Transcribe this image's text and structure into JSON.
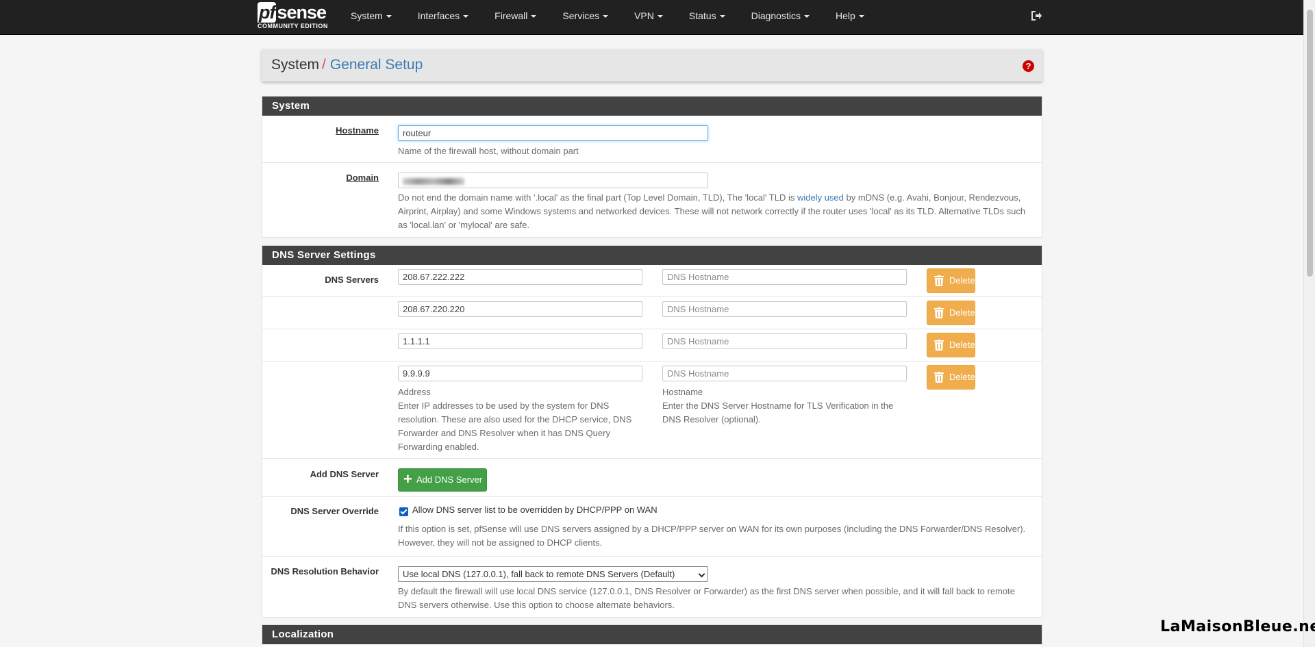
{
  "navbar": {
    "brand": "sense",
    "brand_pf": "pf",
    "edition": "COMMUNITY EDITION",
    "menu": [
      "System",
      "Interfaces",
      "Firewall",
      "Services",
      "VPN",
      "Status",
      "Diagnostics",
      "Help"
    ]
  },
  "breadcrumb": {
    "parent": "System",
    "separator": "/",
    "current": "General Setup"
  },
  "system": {
    "heading": "System",
    "hostname_label": "Hostname",
    "hostname_value": "routeur",
    "hostname_help": "Name of the firewall host, without domain part",
    "domain_label": "Domain",
    "domain_help_1": "Do not end the domain name with '.local' as the final part (Top Level Domain, TLD), The 'local' TLD is ",
    "domain_help_link": "widely used",
    "domain_help_2": " by mDNS (e.g. Avahi, Bonjour, Rendezvous, Airprint, Airplay) and some Windows systems and networked devices. These will not network correctly if the router uses 'local' as its TLD. Alternative TLDs such as 'local.lan' or 'mylocal' are safe."
  },
  "dns": {
    "heading": "DNS Server Settings",
    "servers_label": "DNS Servers",
    "hostname_placeholder": "DNS Hostname",
    "delete_label": "Delete",
    "servers": [
      "208.67.222.222",
      "208.67.220.220",
      "1.1.1.1",
      "9.9.9.9"
    ],
    "address_title": "Address",
    "address_help": "Enter IP addresses to be used by the system for DNS resolution. These are also used for the DHCP service, DNS Forwarder and DNS Resolver when it has DNS Query Forwarding enabled.",
    "hostname_title": "Hostname",
    "hostname_help": "Enter the DNS Server Hostname for TLS Verification in the DNS Resolver (optional).",
    "add_label": "Add DNS Server",
    "add_button": "Add DNS Server",
    "override_label": "DNS Server Override",
    "override_checkbox": "Allow DNS server list to be overridden by DHCP/PPP on WAN",
    "override_checked": true,
    "override_help": "If this option is set, pfSense will use DNS servers assigned by a DHCP/PPP server on WAN for its own purposes (including the DNS Forwarder/DNS Resolver). However, they will not be assigned to DHCP clients.",
    "resolution_label": "DNS Resolution Behavior",
    "resolution_value": "Use local DNS (127.0.0.1), fall back to remote DNS Servers (Default)",
    "resolution_help": "By default the firewall will use local DNS service (127.0.0.1, DNS Resolver or Forwarder) as the first DNS server when possible, and it will fall back to remote DNS servers otherwise. Use this option to choose alternate behaviors."
  },
  "localization": {
    "heading": "Localization"
  },
  "watermark": "LaMaisonBleue.net",
  "colors": {
    "navbar": "#212121",
    "panel_heading": "#424242",
    "link": "#3c7ab5",
    "delete": "#f0ad4e",
    "add": "#43a047"
  }
}
